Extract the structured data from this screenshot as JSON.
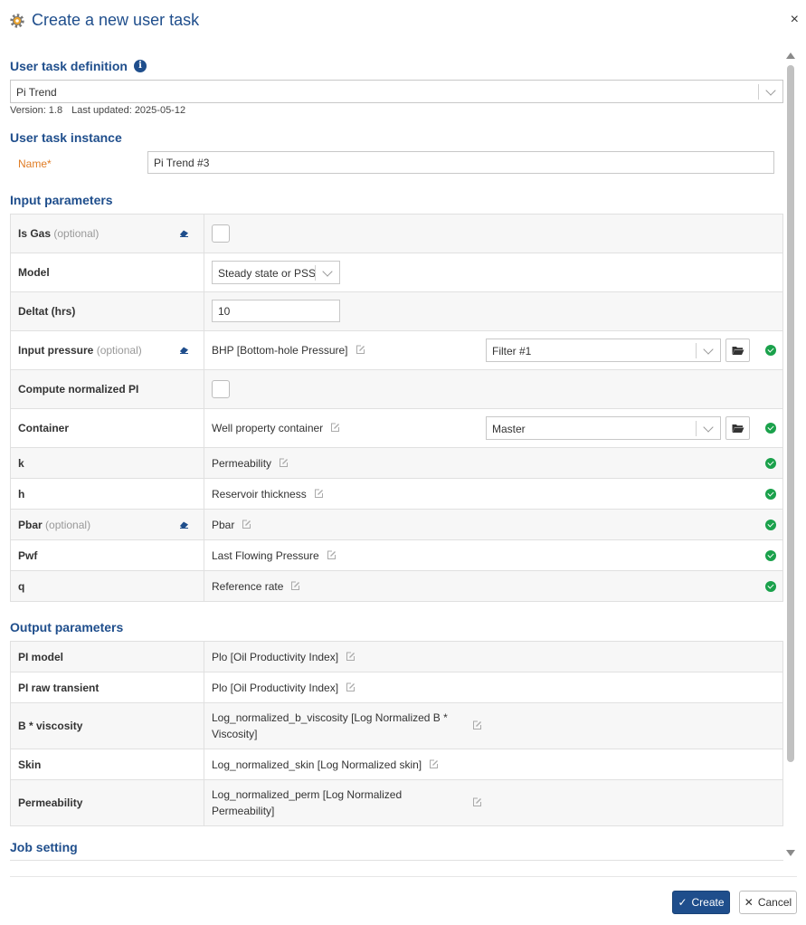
{
  "dialog": {
    "title": "Create a new user task",
    "icon": "gear-icon",
    "close_label": "×"
  },
  "definition": {
    "section_title": "User task definition",
    "selected": "Pi Trend",
    "version_label": "Version: 1.8",
    "updated_label": "Last updated: 2025-05-12"
  },
  "instance": {
    "section_title": "User task instance",
    "name_label": "Name",
    "required_mark": "*",
    "name_value": "Pi Trend #3"
  },
  "inputs": {
    "section_title": "Input parameters",
    "rows": [
      {
        "label": "Is Gas",
        "optional": "(optional)"
      },
      {
        "label": "Model",
        "select": "Steady state or PSS"
      },
      {
        "label": "Deltat (hrs)",
        "value": "10"
      },
      {
        "label": "Input pressure",
        "optional": "(optional)",
        "variable": "BHP [Bottom-hole Pressure]",
        "filter": "Filter #1"
      },
      {
        "label": "Compute normalized PI"
      },
      {
        "label": "Container",
        "variable": "Well property container",
        "filter": "Master"
      },
      {
        "label": "k",
        "variable": "Permeability"
      },
      {
        "label": "h",
        "variable": "Reservoir thickness"
      },
      {
        "label": "Pbar",
        "optional": "(optional)",
        "variable": "Pbar"
      },
      {
        "label": "Pwf",
        "variable": "Last Flowing Pressure"
      },
      {
        "label": "q",
        "variable": "Reference rate"
      }
    ]
  },
  "outputs": {
    "section_title": "Output parameters",
    "rows": [
      {
        "label": "PI model",
        "variable": "Plo [Oil Productivity Index]"
      },
      {
        "label": "PI raw transient",
        "variable": "Plo [Oil Productivity Index]"
      },
      {
        "label": "B * viscosity",
        "variable": "Log_normalized_b_viscosity [Log Normalized B * Viscosity]"
      },
      {
        "label": "Skin",
        "variable": "Log_normalized_skin [Log Normalized skin]"
      },
      {
        "label": "Permeability",
        "variable": "Log_normalized_perm [Log Normalized Permeability]"
      }
    ]
  },
  "job": {
    "section_title": "Job setting"
  },
  "footer": {
    "create_label": "Create",
    "cancel_label": "Cancel"
  },
  "colors": {
    "accent": "#1f4e8c",
    "success": "#1aa14b",
    "required": "#e07c24"
  }
}
